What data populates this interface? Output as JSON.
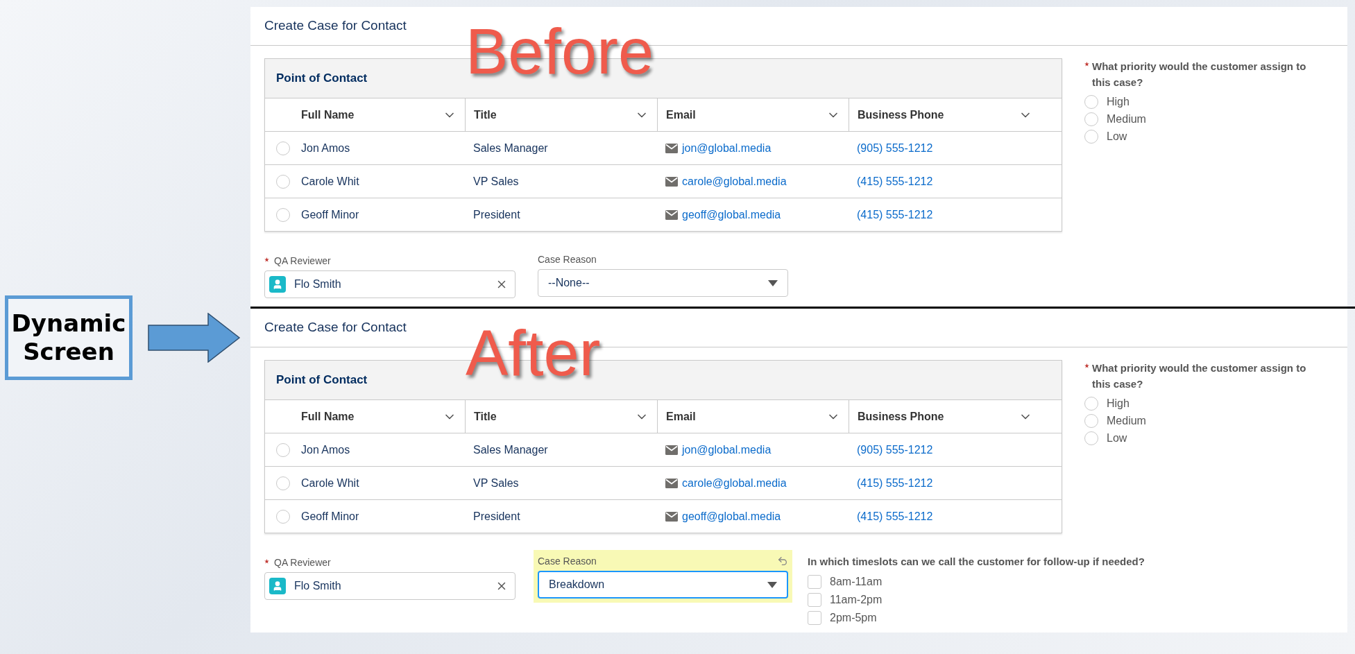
{
  "slide": {
    "label_box": "Dynamic Screen"
  },
  "screens": [
    {
      "overlay_label": "Before",
      "title": "Create Case for Contact",
      "table": {
        "title": "Point of Contact",
        "columns": [
          "Full Name",
          "Title",
          "Email",
          "Business Phone"
        ],
        "rows": [
          {
            "selected": false,
            "full_name": "Jon Amos",
            "title": "Sales Manager",
            "email": "jon@global.media",
            "phone": "(905) 555-1212"
          },
          {
            "selected": false,
            "full_name": "Carole Whit",
            "title": "VP Sales",
            "email": "carole@global.media",
            "phone": "(415) 555-1212"
          },
          {
            "selected": false,
            "full_name": "Geoff Minor",
            "title": "President",
            "email": "geoff@global.media",
            "phone": "(415) 555-1212"
          }
        ]
      },
      "reviewer": {
        "label": "QA Reviewer",
        "required": true,
        "value": "Flo Smith"
      },
      "case_reason": {
        "label": "Case Reason",
        "value": "--None--",
        "changed": false
      },
      "priority": {
        "question": "What priority would the customer assign to this case?",
        "required": true,
        "options": [
          {
            "label": "High",
            "selected": false
          },
          {
            "label": "Medium",
            "selected": false
          },
          {
            "label": "Low",
            "selected": false
          }
        ]
      }
    },
    {
      "overlay_label": "After",
      "title": "Create Case for Contact",
      "table": {
        "title": "Point of Contact",
        "columns": [
          "Full Name",
          "Title",
          "Email",
          "Business Phone"
        ],
        "rows": [
          {
            "selected": false,
            "full_name": "Jon Amos",
            "title": "Sales Manager",
            "email": "jon@global.media",
            "phone": "(905) 555-1212"
          },
          {
            "selected": false,
            "full_name": "Carole Whit",
            "title": "VP Sales",
            "email": "carole@global.media",
            "phone": "(415) 555-1212"
          },
          {
            "selected": false,
            "full_name": "Geoff Minor",
            "title": "President",
            "email": "geoff@global.media",
            "phone": "(415) 555-1212"
          }
        ]
      },
      "reviewer": {
        "label": "QA Reviewer",
        "required": true,
        "value": "Flo Smith"
      },
      "case_reason": {
        "label": "Case Reason",
        "value": "Breakdown",
        "changed": true
      },
      "timeslots": {
        "question": "In which timeslots can we call the customer for follow-up if needed?",
        "options": [
          {
            "label": "8am-11am",
            "checked": false
          },
          {
            "label": "11am-2pm",
            "checked": false
          },
          {
            "label": "2pm-5pm",
            "checked": false
          }
        ]
      },
      "priority": {
        "question": "What priority would the customer assign to this case?",
        "required": true,
        "options": [
          {
            "label": "High",
            "selected": false
          },
          {
            "label": "Medium",
            "selected": false
          },
          {
            "label": "Low",
            "selected": false
          }
        ]
      }
    }
  ]
}
